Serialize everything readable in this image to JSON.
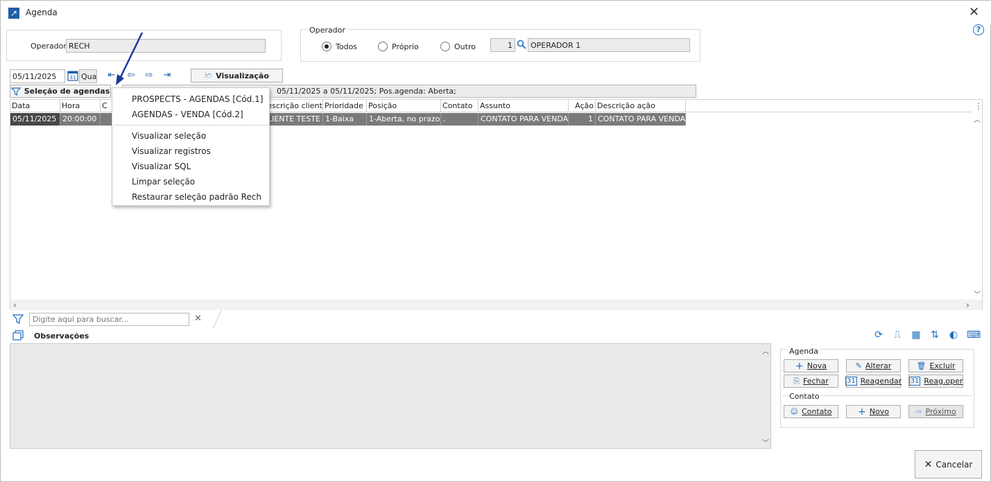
{
  "window": {
    "title": "Agenda",
    "close_icon": "close-icon",
    "help_label": "?"
  },
  "operator_box": {
    "label": "Operador",
    "value": "RECH"
  },
  "operator_group": {
    "title": "Operador",
    "options": [
      {
        "label": "Todos",
        "selected": true
      },
      {
        "label": "Próprio",
        "selected": false
      },
      {
        "label": "Outro",
        "selected": false
      }
    ],
    "code": "1",
    "name": "OPERADOR 1"
  },
  "date_bar": {
    "date": "05/11/2025",
    "weekday": "Qua",
    "view_button": "Visualização"
  },
  "selection": {
    "button_label": "Seleção de agendas",
    "summary": "05/11/2025 a 05/11/2025; Pos.agenda: Aberta;"
  },
  "dropdown_menu": {
    "items_top": [
      "PROSPECTS - AGENDAS [Cód.1]",
      "AGENDAS - VENDA [Cód.2]"
    ],
    "items_bottom": [
      "Visualizar seleção",
      "Visualizar registros",
      "Visualizar SQL",
      "Limpar seleção",
      "Restaurar seleção padrão Rech"
    ]
  },
  "grid": {
    "columns": [
      "Data",
      "Hora",
      "C",
      "",
      "Descrição cliente",
      "Prioridade",
      "Posição",
      "Contato",
      "Assunto",
      "Ação",
      "Descrição ação"
    ],
    "rows": [
      [
        "05/11/2025",
        "20:00:00",
        "",
        "",
        "CLIENTE TESTE",
        "1-Baixa",
        "1-Aberta, no prazo",
        ".",
        "CONTATO PARA VENDA",
        "1",
        "CONTATO PARA VENDA"
      ]
    ]
  },
  "search": {
    "placeholder": "Digite aqui para buscar..."
  },
  "observations": {
    "label": "Observações"
  },
  "agenda_panel": {
    "title": "Agenda",
    "buttons": [
      "Nova",
      "Alterar",
      "Excluir",
      "Fechar",
      "Reagendar",
      "Reag.oper"
    ]
  },
  "contact_panel": {
    "title": "Contato",
    "buttons": [
      "Contato",
      "Novo",
      "Próximo"
    ]
  },
  "cancel_button": "Cancelar"
}
